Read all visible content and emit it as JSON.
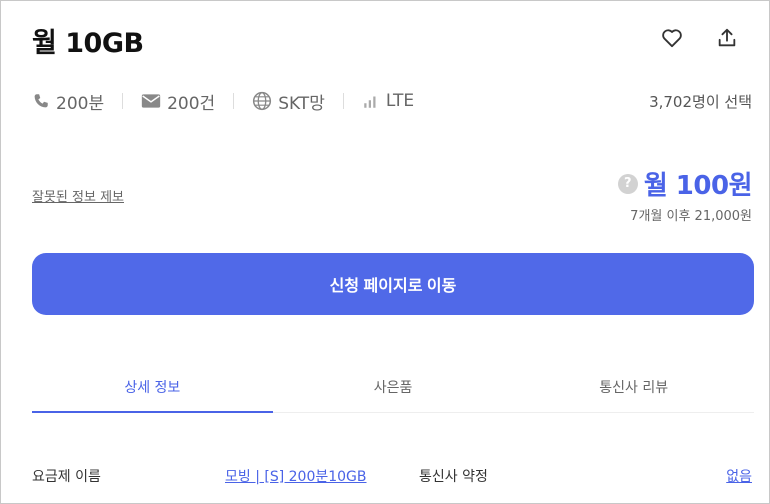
{
  "header": {
    "title": "월 10GB"
  },
  "icons": {
    "heart": "heart-icon",
    "share": "share-icon"
  },
  "specs": {
    "call": "200분",
    "sms": "200건",
    "network": "SKT망",
    "type": "LTE"
  },
  "selected_count": "3,702명이 선택",
  "report_link": "잘못된 정보 제보",
  "price": {
    "help": "?",
    "main": "월 100원",
    "after": "7개월 이후 21,000원"
  },
  "apply_button": "신청 페이지로 이동",
  "tabs": [
    {
      "label": "상세 정보",
      "active": true
    },
    {
      "label": "사은품",
      "active": false
    },
    {
      "label": "통신사 리뷰",
      "active": false
    }
  ],
  "detail": {
    "plan_name_label": "요금제 이름",
    "plan_name_value": "모빙 | [S] 200분10GB",
    "contract_label": "통신사 약정",
    "contract_value": "없음"
  },
  "colors": {
    "accent": "#4a63e7",
    "button": "#5069e8"
  }
}
